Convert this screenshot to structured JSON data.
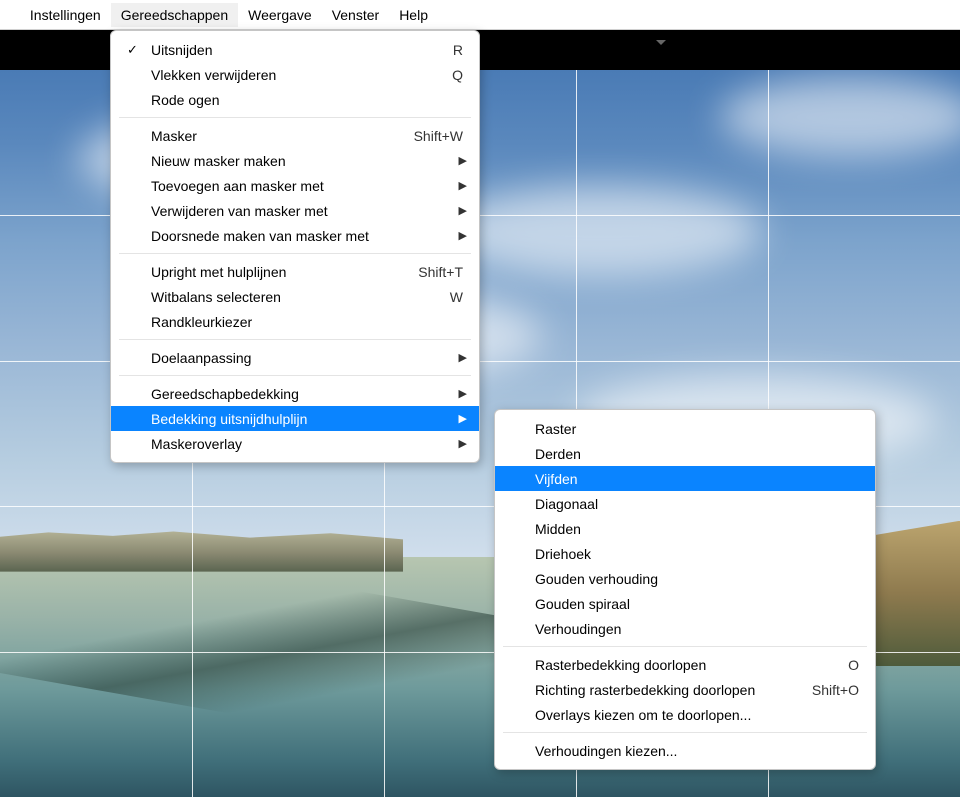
{
  "menubar": {
    "items": [
      {
        "label": "Instellingen"
      },
      {
        "label": "Gereedschappen"
      },
      {
        "label": "Weergave"
      },
      {
        "label": "Venster"
      },
      {
        "label": "Help"
      }
    ]
  },
  "menu1": {
    "items": [
      {
        "label": "Uitsnijden",
        "shortcut": "R",
        "checked": true
      },
      {
        "label": "Vlekken verwijderen",
        "shortcut": "Q"
      },
      {
        "label": "Rode ogen"
      },
      {
        "sep": true
      },
      {
        "label": "Masker",
        "shortcut": "Shift+W"
      },
      {
        "label": "Nieuw masker maken",
        "submenu": true
      },
      {
        "label": "Toevoegen aan masker met",
        "submenu": true
      },
      {
        "label": "Verwijderen van masker met",
        "submenu": true
      },
      {
        "label": "Doorsnede maken van masker met",
        "submenu": true
      },
      {
        "sep": true
      },
      {
        "label": "Upright met hulplijnen",
        "shortcut": "Shift+T"
      },
      {
        "label": "Witbalans selecteren",
        "shortcut": "W"
      },
      {
        "label": "Randkleurkiezer"
      },
      {
        "sep": true
      },
      {
        "label": "Doelaanpassing",
        "submenu": true
      },
      {
        "sep": true
      },
      {
        "label": "Gereedschapbedekking",
        "submenu": true
      },
      {
        "label": "Bedekking uitsnijdhulplijn",
        "submenu": true,
        "selected": true
      },
      {
        "label": "Maskeroverlay",
        "submenu": true
      }
    ]
  },
  "menu2": {
    "items": [
      {
        "label": "Raster"
      },
      {
        "label": "Derden"
      },
      {
        "label": "Vijfden",
        "selected": true
      },
      {
        "label": "Diagonaal"
      },
      {
        "label": "Midden"
      },
      {
        "label": "Driehoek"
      },
      {
        "label": "Gouden verhouding"
      },
      {
        "label": "Gouden spiraal"
      },
      {
        "label": "Verhoudingen"
      },
      {
        "sep": true
      },
      {
        "label": "Rasterbedekking doorlopen",
        "shortcut": "O"
      },
      {
        "label": "Richting rasterbedekking doorlopen",
        "shortcut": "Shift+O"
      },
      {
        "label": "Overlays kiezen om te doorlopen..."
      },
      {
        "sep": true
      },
      {
        "label": "Verhoudingen kiezen..."
      }
    ]
  }
}
